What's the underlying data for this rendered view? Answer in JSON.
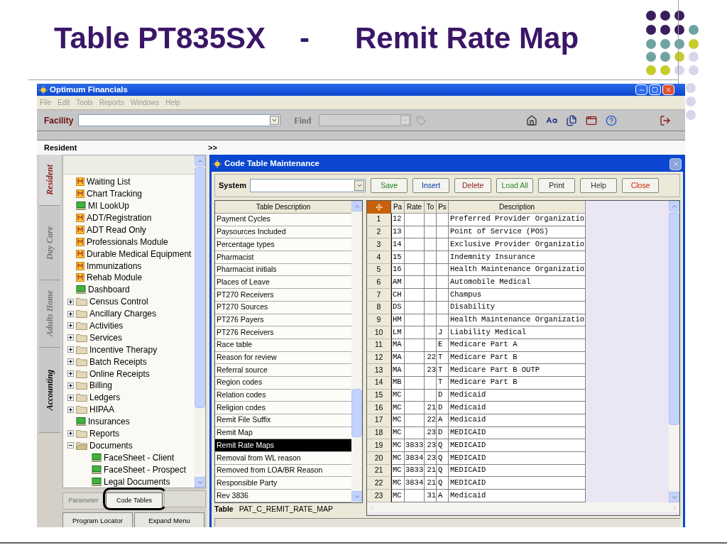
{
  "slide": {
    "title": "Table PT835SX",
    "separator": "-",
    "subtitle": "Remit Rate Map"
  },
  "app": {
    "title": "Optimum Financials",
    "menu": [
      "File",
      "Edit",
      "Tools",
      "Reports",
      "Windows",
      "Help"
    ],
    "facility_label": "Facility",
    "find_label": "Find",
    "resident_label": "Resident",
    "expand_label": ">>",
    "side_tabs": [
      {
        "label": "Resident",
        "selected": true,
        "disabled": false
      },
      {
        "label": "Day Care",
        "selected": false,
        "disabled": true
      },
      {
        "label": "Adults Home",
        "selected": false,
        "disabled": true
      },
      {
        "label": "Accounting",
        "selected": false,
        "disabled": false
      }
    ],
    "tree": [
      {
        "label": "Waiting List",
        "kind": "module"
      },
      {
        "label": "Chart Tracking",
        "kind": "module"
      },
      {
        "label": "MI LookUp",
        "kind": "screen"
      },
      {
        "label": "ADT/Registration",
        "kind": "module"
      },
      {
        "label": "ADT Read Only",
        "kind": "module"
      },
      {
        "label": "Professionals Module",
        "kind": "module"
      },
      {
        "label": "Durable Medical Equipment",
        "kind": "module"
      },
      {
        "label": "Immunizations",
        "kind": "module"
      },
      {
        "label": "Rehab Module",
        "kind": "module"
      },
      {
        "label": "Dashboard",
        "kind": "screen"
      },
      {
        "label": "Census Control",
        "kind": "folder",
        "expanded": false
      },
      {
        "label": "Ancillary Charges",
        "kind": "folder",
        "expanded": false
      },
      {
        "label": "Activities",
        "kind": "folder",
        "expanded": false
      },
      {
        "label": "Services",
        "kind": "folder",
        "expanded": false
      },
      {
        "label": "Incentive Therapy",
        "kind": "folder",
        "expanded": false
      },
      {
        "label": "Batch Receipts",
        "kind": "folder",
        "expanded": false
      },
      {
        "label": "Online Receipts",
        "kind": "folder",
        "expanded": false
      },
      {
        "label": "Billing",
        "kind": "folder",
        "expanded": false
      },
      {
        "label": "Ledgers",
        "kind": "folder",
        "expanded": false
      },
      {
        "label": "HIPAA",
        "kind": "folder",
        "expanded": false
      },
      {
        "label": "Insurances",
        "kind": "screen"
      },
      {
        "label": "Reports",
        "kind": "folder",
        "expanded": false
      },
      {
        "label": "Documents",
        "kind": "folder",
        "expanded": true,
        "children": [
          {
            "label": "FaceSheet - Client",
            "kind": "screen"
          },
          {
            "label": "FaceSheet - Prospect",
            "kind": "screen"
          },
          {
            "label": "Legal Documents",
            "kind": "screen"
          }
        ]
      }
    ],
    "panel_buttons": [
      {
        "label": "Parameter",
        "disabled": true
      },
      {
        "label": "Code Tables",
        "disabled": false
      },
      {
        "disabled": true
      }
    ],
    "menu_buttons": [
      "Program Locator",
      "Expand Menu"
    ]
  },
  "dialog": {
    "title": "Code Table Maintenance",
    "system_label": "System",
    "buttons": [
      {
        "label": "Save",
        "color": "#1a7a1a"
      },
      {
        "label": "Insert",
        "color": "#0033aa"
      },
      {
        "label": "Delete",
        "color": "#8a1a1a"
      },
      {
        "label": "Load All",
        "color": "#2a8a2a"
      },
      {
        "label": "Print",
        "color": "#222222"
      },
      {
        "label": "Help",
        "color": "#333333"
      },
      {
        "label": "Close",
        "color": "#cc2200"
      }
    ],
    "table_list": {
      "header": "Table Description",
      "items": [
        {
          "label": "Payment Cycles",
          "selected": false
        },
        {
          "label": "Paysources Included",
          "selected": false
        },
        {
          "label": "Percentage types",
          "selected": false
        },
        {
          "label": "Pharmacist",
          "selected": false
        },
        {
          "label": "Pharmacist initials",
          "selected": false
        },
        {
          "label": "Places of Leave",
          "selected": false
        },
        {
          "label": "PT270 Receivers",
          "selected": false
        },
        {
          "label": "PT270 Sources",
          "selected": false
        },
        {
          "label": "PT276 Payers",
          "selected": false
        },
        {
          "label": "PT276 Receivers",
          "selected": false
        },
        {
          "label": "Race table",
          "selected": false
        },
        {
          "label": "Reason for review",
          "selected": false
        },
        {
          "label": "Referral source",
          "selected": false
        },
        {
          "label": "Region codes",
          "selected": false
        },
        {
          "label": "Relation codes",
          "selected": false
        },
        {
          "label": "Religion codes",
          "selected": false
        },
        {
          "label": "Remit File Suffix",
          "selected": false
        },
        {
          "label": "Remit Map",
          "selected": false
        },
        {
          "label": "Remit Rate Maps",
          "selected": true
        },
        {
          "label": "Removal from WL reason",
          "selected": false
        },
        {
          "label": "Removed from LOA/BR Reason",
          "selected": false
        },
        {
          "label": "Responsible Party",
          "selected": false
        },
        {
          "label": "Rev 3836",
          "selected": false
        }
      ]
    },
    "table_label": "Table",
    "table_name": "PAT_C_REMIT_RATE_MAP",
    "grid": {
      "columns": [
        "Pa",
        "Rate",
        "To",
        "Ps",
        "Description"
      ],
      "rows": [
        {
          "number": "1",
          "pa": "12",
          "description": "Preferred Provider Organizatio"
        },
        {
          "number": "2",
          "pa": "13",
          "description": "Point of Service (POS)"
        },
        {
          "number": "3",
          "pa": "14",
          "description": "Exclusive Provider Organizatio"
        },
        {
          "number": "4",
          "pa": "15",
          "description": "Indemnity Insurance"
        },
        {
          "number": "5",
          "pa": "16",
          "description": "Health Maintenance Organizatio"
        },
        {
          "number": "6",
          "pa": "AM",
          "description": "Automobile Medical"
        },
        {
          "number": "7",
          "pa": "CH",
          "description": "Champus"
        },
        {
          "number": "8",
          "pa": "DS",
          "description": "Disability"
        },
        {
          "number": "9",
          "pa": "HM",
          "description": "Health Maintenance Organizatio"
        },
        {
          "number": "10",
          "pa": "LM",
          "ps": "J",
          "description": "Liability Medical"
        },
        {
          "number": "11",
          "pa": "MA",
          "ps": "E",
          "description": "Medicare Part A"
        },
        {
          "number": "12",
          "pa": "MA",
          "to": "22",
          "ps": "T",
          "description": "Medicare Part B"
        },
        {
          "number": "13",
          "pa": "MA",
          "to": "23",
          "ps": "T",
          "description": "Medicare Part B OUTP"
        },
        {
          "number": "14",
          "pa": "MB",
          "ps": "T",
          "description": "Medicare Part B"
        },
        {
          "number": "15",
          "pa": "MC",
          "ps": "D",
          "description": "Medicaid"
        },
        {
          "number": "16",
          "pa": "MC",
          "to": "21",
          "ps": "D",
          "description": "Medicaid"
        },
        {
          "number": "17",
          "pa": "MC",
          "to": "22",
          "ps": "A",
          "description": "Medicaid"
        },
        {
          "number": "18",
          "pa": "MC",
          "to": "23",
          "ps": "D",
          "description": "MEDICAID"
        },
        {
          "number": "19",
          "pa": "MC",
          "rate": "3833",
          "to": "23",
          "ps": "Q",
          "description": "MEDICAID"
        },
        {
          "number": "20",
          "pa": "MC",
          "rate": "3834",
          "to": "23",
          "ps": "Q",
          "description": "MEDICAID"
        },
        {
          "number": "21",
          "pa": "MC",
          "rate": "3833",
          "to": "21",
          "ps": "Q",
          "description": "MEDICAID"
        },
        {
          "number": "22",
          "pa": "MC",
          "rate": "3834",
          "to": "21",
          "ps": "Q",
          "description": "MEDICAID"
        },
        {
          "number": "23",
          "pa": "MC",
          "to": "31",
          "ps": "A",
          "description": "Medicaid"
        }
      ]
    }
  }
}
